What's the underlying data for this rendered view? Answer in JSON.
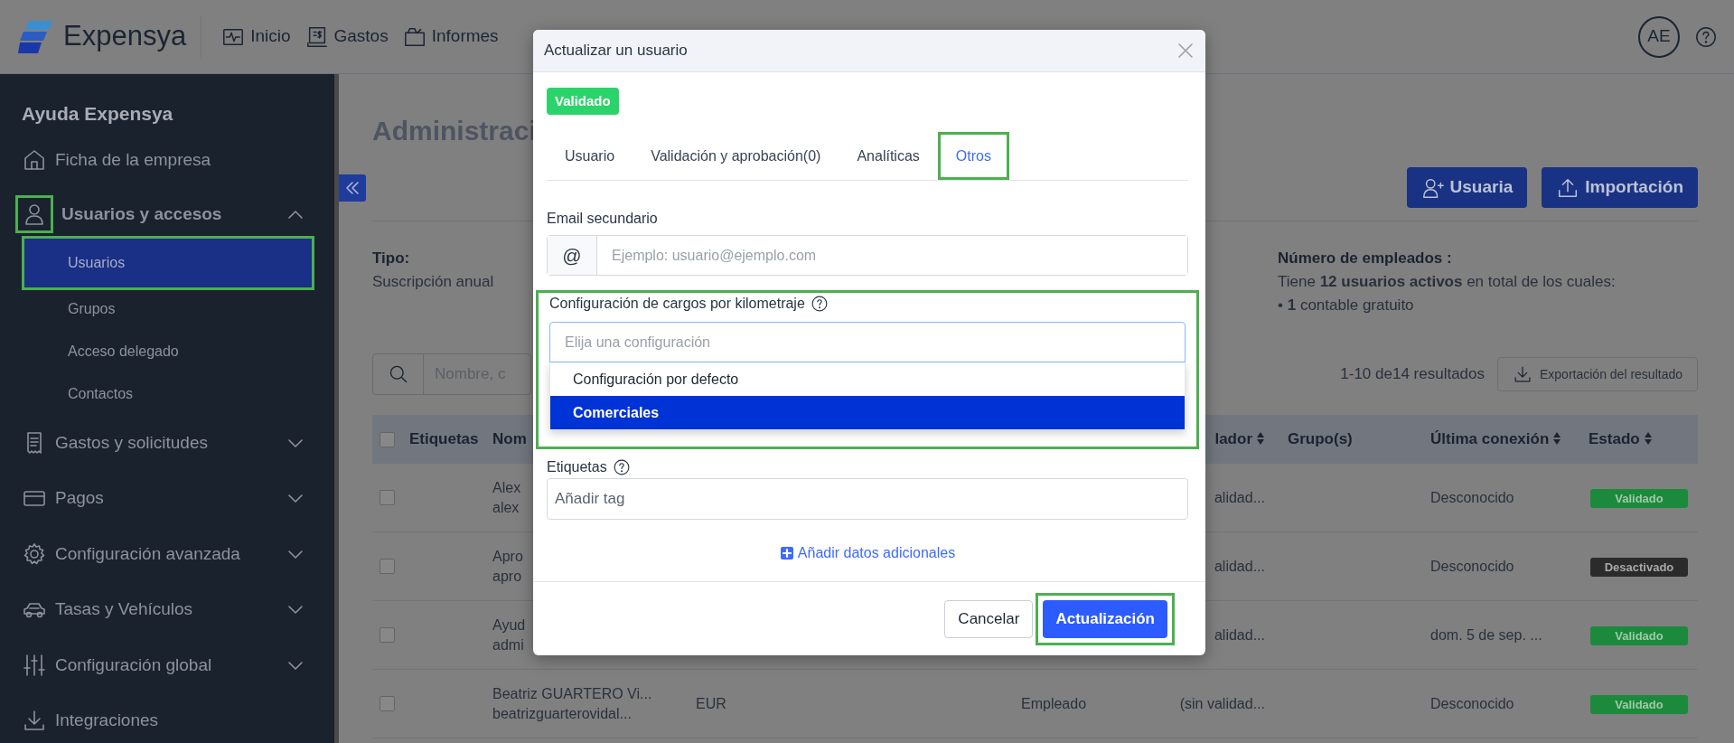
{
  "app": {
    "logo": "Expensya",
    "nav": [
      {
        "label": "Inicio"
      },
      {
        "label": "Gastos"
      },
      {
        "label": "Informes"
      }
    ],
    "avatar": "AE"
  },
  "sidebar": {
    "title": "Ayuda Expensya",
    "items": [
      {
        "label": "Ficha de la empresa"
      },
      {
        "label": "Usuarios y accesos",
        "expanded": true,
        "highlighted": true,
        "children": [
          {
            "label": "Usuarios",
            "selected": true,
            "highlighted": true
          },
          {
            "label": "Grupos",
            "selected": false,
            "highlighted": false
          },
          {
            "label": "Acceso delegado",
            "selected": false,
            "highlighted": false
          },
          {
            "label": "Contactos",
            "selected": false,
            "highlighted": false
          }
        ]
      },
      {
        "label": "Gastos y solicitudes",
        "expanded": false
      },
      {
        "label": "Pagos",
        "expanded": false
      },
      {
        "label": "Configuración avanzada",
        "expanded": false
      },
      {
        "label": "Tasas y Vehículos",
        "expanded": false
      },
      {
        "label": "Configuración global",
        "expanded": false
      },
      {
        "label": "Integraciones"
      }
    ]
  },
  "page": {
    "title": "Administraci",
    "buttons": [
      {
        "label": "Usuaria",
        "kind": "add-user"
      },
      {
        "label": "Importación",
        "kind": "import"
      }
    ],
    "type_label": "Tipo:",
    "type_value": "Suscripción anual",
    "employees_title": "Número de empleados :",
    "employees_lines": [
      "Tiene **12 usuarios activos** en total de los cuales:",
      "• **1** contable gratuito"
    ],
    "search_placeholder": "Nombre, c",
    "results": "1-10 de14 resultados",
    "export": "Exportación del resultado"
  },
  "table": {
    "select_all": false,
    "columns": [
      {
        "label": "Etiquetas",
        "sortable": false
      },
      {
        "label": "Nom",
        "sortable": false
      },
      {
        "label": "lador",
        "sortable": true
      },
      {
        "label": "Grupo(s)",
        "sortable": false
      },
      {
        "label": "Última conexión",
        "sortable": true
      },
      {
        "label": "Estado",
        "sortable": true
      }
    ],
    "rows": [
      {
        "checked": false,
        "name": "Alex",
        "email": "alex",
        "validator": "alidad...",
        "last_login": "Desconocido",
        "status": {
          "label": "Validado",
          "kind": "validated"
        }
      },
      {
        "checked": false,
        "name": "Apro",
        "email": "apro",
        "validator": "alidad...",
        "last_login": "Desconocido",
        "status": {
          "label": "Desactivado",
          "kind": "deactivated"
        }
      },
      {
        "checked": false,
        "name": "Ayud",
        "email": "admi",
        "validator": "alidad...",
        "last_login": "dom. 5 de sep. ...",
        "status": {
          "label": "Validado",
          "kind": "validated"
        }
      },
      {
        "checked": false,
        "name": "Beatriz GUARTERO Vi...",
        "email": "beatrizguarterovidal...",
        "currency": "EUR",
        "role": "Empleado",
        "validator": "(sin validad...",
        "last_login": "Desconocido",
        "status": {
          "label": "Validado",
          "kind": "validated"
        }
      }
    ]
  },
  "modal": {
    "title": "Actualizar un usuario",
    "status_badge": "Validado",
    "tabs": [
      {
        "label": "Usuario",
        "selected": false,
        "highlighted": false
      },
      {
        "label": "Validación y aprobación(0)",
        "selected": false,
        "highlighted": false
      },
      {
        "label": "Analíticas",
        "selected": false,
        "highlighted": false
      },
      {
        "label": "Otros",
        "selected": true,
        "highlighted": true
      }
    ],
    "email_label": "Email secundario",
    "email_addon": "@",
    "email_placeholder": "Ejemplo: usuario@ejemplo.com",
    "mileage": {
      "label": "Configuración de cargos por kilometraje",
      "placeholder": "Elija una configuración",
      "highlighted": true,
      "options": [
        {
          "label": "Configuración por defecto",
          "selected": false
        },
        {
          "label": "Comerciales",
          "selected": true
        }
      ]
    },
    "tags_label": "Etiquetas",
    "tags_placeholder": "Añadir tag",
    "add_link": "Añadir datos adicionales",
    "buttons": [
      {
        "label": "Cancelar",
        "kind": "secondary",
        "highlighted": false
      },
      {
        "label": "Actualización",
        "kind": "primary",
        "highlighted": true
      }
    ]
  }
}
